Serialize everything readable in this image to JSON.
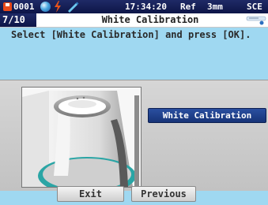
{
  "status_bar": {
    "sample_no": "0001",
    "time": "17:34:20",
    "ref": "Ref",
    "aperture": "3mm",
    "mode": "SCE",
    "icons": [
      "disk-icon",
      "led-icon",
      "bolt-icon",
      "pen-icon"
    ]
  },
  "title_bar": {
    "step": "7/10",
    "title": "White Calibration",
    "menu_icon": "menu-icon"
  },
  "instruction": "Select [White Calibration] and press [OK].",
  "main": {
    "image": "white-calibration-cap-illustration",
    "white_calibration_button": "White Calibration"
  },
  "footer": {
    "exit_label": "Exit",
    "previous_label": "Previous"
  },
  "colors": {
    "status_bar_bg": "#0d1547",
    "screen_bg": "#9fd8f1",
    "panel_bg": "#c8c8c8",
    "button_blue": "#1f3f8c",
    "cap_teal": "#2aa5a5"
  }
}
